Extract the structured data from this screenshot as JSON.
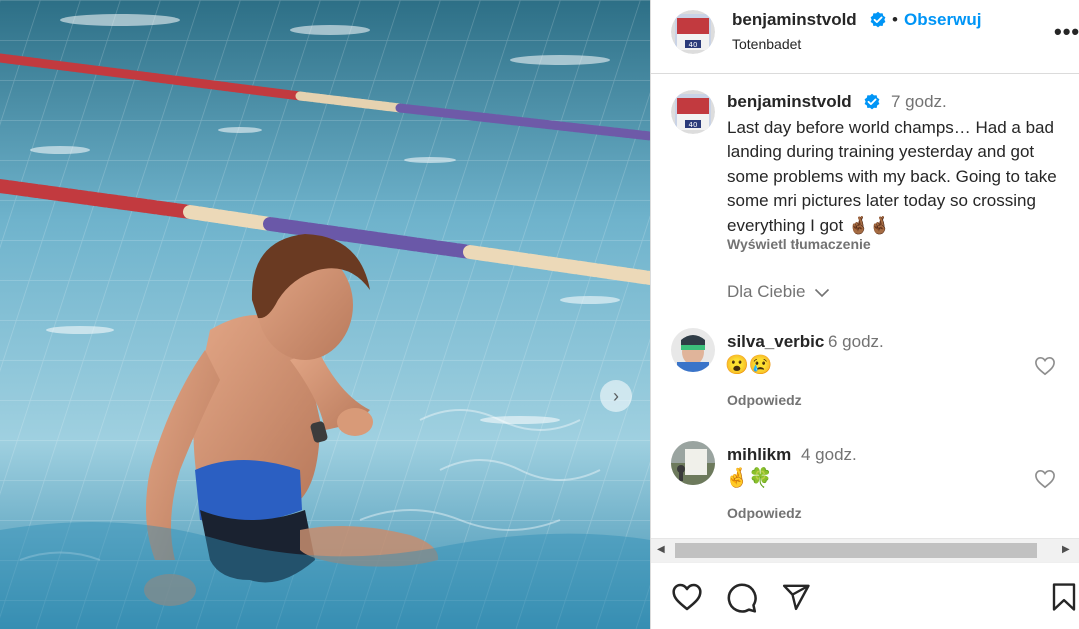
{
  "post": {
    "author": "benjaminstvold",
    "follow_label": "Obserwuj",
    "dot": "•",
    "location": "Totenbadet",
    "more_label": "•••",
    "caption_time": "7 godz.",
    "caption_text": "Last day before world champs… Had a bad landing during training yesterday and got some problems with my back. Going to take some mri pictures later today so crossing everything I got 🤞🏾🤞🏾",
    "translate_label": "Wyświetl tłumaczenie",
    "for_you_label": "Dla Ciebie",
    "next_glyph": "›"
  },
  "comments": [
    {
      "user": "silva_verbic",
      "time": "6 godz.",
      "text": "😮😢",
      "reply_label": "Odpowiedz"
    },
    {
      "user": "mihlikm",
      "time": "4 godz.",
      "text": "🤞🍀",
      "reply_label": "Odpowiedz"
    }
  ],
  "scrollbar": {
    "left_arrow": "◀",
    "right_arrow": "▶"
  },
  "icons": {
    "verified": "verified-badge-icon",
    "like": "heart-icon",
    "comment": "comment-bubble-icon",
    "share": "paper-plane-icon",
    "save": "bookmark-icon",
    "chevron": "chevron-down-icon"
  },
  "colors": {
    "accent": "#0095f6",
    "text": "#262626",
    "muted": "#737373",
    "border": "#dbdbdb",
    "pool": "#7fb6d0"
  }
}
